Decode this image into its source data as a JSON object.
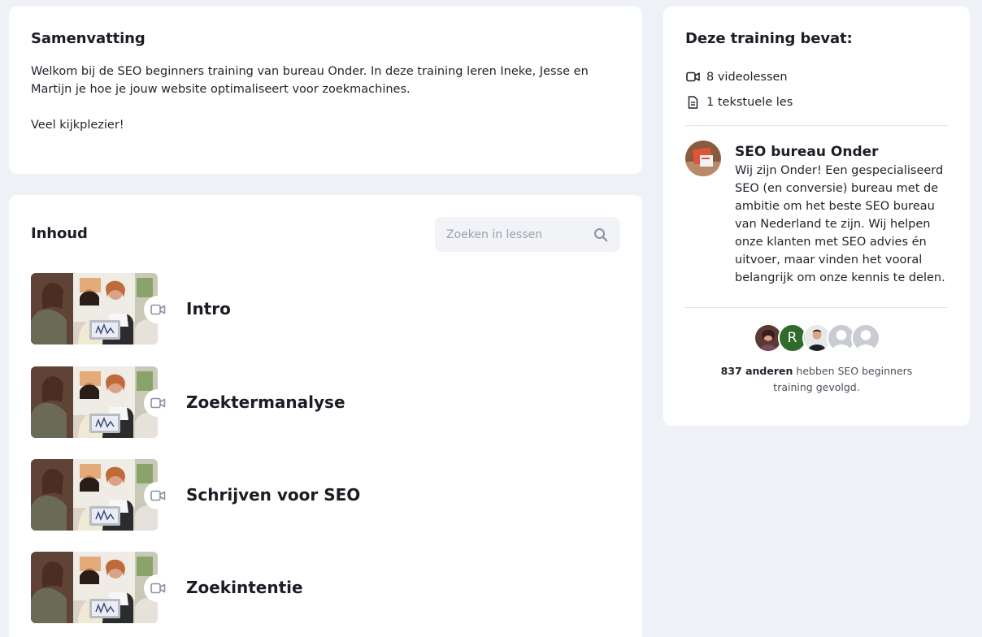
{
  "summary": {
    "title": "Samenvatting",
    "paragraph_1": "Welkom bij de SEO beginners training van bureau Onder. In deze training leren Ineke, Jesse en Martijn je hoe je jouw website optimaliseert voor zoekmachines.",
    "paragraph_2": "Veel kijkplezier!"
  },
  "content": {
    "title": "Inhoud",
    "search_placeholder": "Zoeken in lessen",
    "search_icon": "search-icon",
    "lessons": [
      {
        "title": "Intro",
        "type_icon": "video-icon"
      },
      {
        "title": "Zoektermanalyse",
        "type_icon": "video-icon"
      },
      {
        "title": "Schrijven voor SEO",
        "type_icon": "video-icon"
      },
      {
        "title": "Zoekintentie",
        "type_icon": "video-icon"
      }
    ]
  },
  "sidebar": {
    "title": "Deze training bevat:",
    "items": [
      {
        "icon": "video-icon",
        "label": "8 videolessen"
      },
      {
        "icon": "document-icon",
        "label": "1 tekstuele les"
      }
    ],
    "author": {
      "name": "SEO bureau Onder",
      "description": "Wij zijn Onder! Een gespecialiseerd SEO (en conversie) bureau met de ambitie om het beste SEO bureau van Nederland te zijn. Wij helpen onze klanten met SEO advies én uitvoer, maar vinden het vooral belangrijk om onze kennis te delen."
    },
    "followers": {
      "avatar_initial": "R",
      "count_label": "837 anderen",
      "suffix": "hebben SEO beginners training gevolgd."
    }
  },
  "colors": {
    "background": "#eef2f6",
    "card": "#ffffff",
    "text": "#1a1d24",
    "muted_icon": "#8a93a3",
    "avatar_green": "#2f6b2c"
  }
}
